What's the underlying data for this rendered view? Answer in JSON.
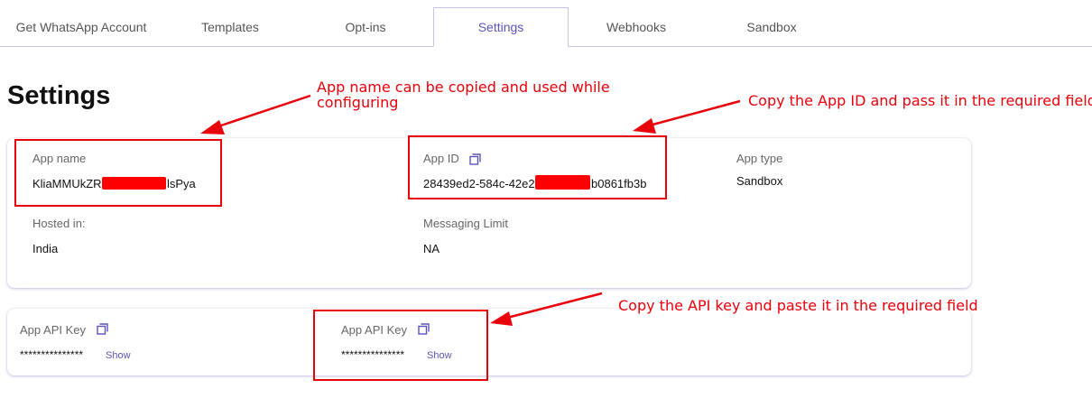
{
  "tabs": [
    {
      "label": "Get WhatsApp Account",
      "active": false
    },
    {
      "label": "Templates",
      "active": false
    },
    {
      "label": "Opt-ins",
      "active": false
    },
    {
      "label": "Settings",
      "active": true
    },
    {
      "label": "Webhooks",
      "active": false
    },
    {
      "label": "Sandbox",
      "active": false
    }
  ],
  "page_title": "Settings",
  "app_info": {
    "app_name_label": "App name",
    "app_name_start": "KliaMMUkZR",
    "app_name_end": "lsPya",
    "app_id_label": "App ID",
    "app_id_start": "28439ed2-584c-42e2",
    "app_id_end": "b0861fb3b",
    "app_type_label": "App type",
    "app_type_value": "Sandbox",
    "hosted_label": "Hosted in:",
    "hosted_value": "India",
    "messaging_label": "Messaging Limit",
    "messaging_value": "NA"
  },
  "api_keys": [
    {
      "label": "App API Key",
      "value": "***************",
      "show": "Show"
    },
    {
      "label": "App API Key",
      "value": "***************",
      "show": "Show"
    }
  ],
  "annotations": {
    "app_name_note": "App name can be copied and used while configuring",
    "app_id_note": "Copy the App ID and pass it in the required field",
    "api_key_note": "Copy the API key and paste it in the required field",
    "color": "#e8000b"
  },
  "colors": {
    "accent": "#5a54b8",
    "tab_border": "#c9c3e6",
    "redaction": "#ff0000"
  },
  "icons": {
    "copy": "copy-icon"
  }
}
